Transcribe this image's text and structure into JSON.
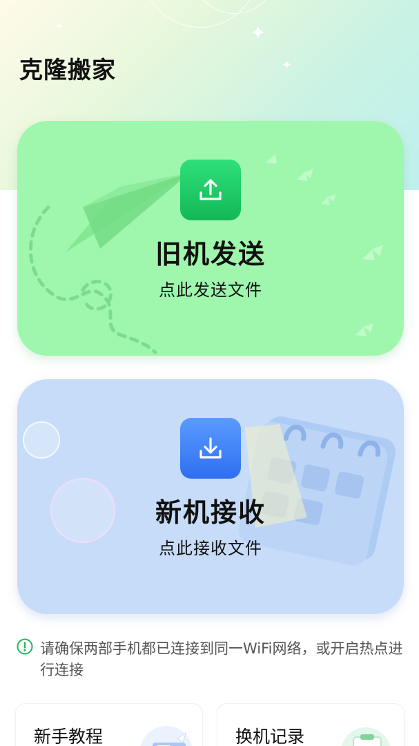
{
  "app": {
    "title": "克隆搬家"
  },
  "send_card": {
    "title": "旧机发送",
    "subtitle": "点此发送文件",
    "icon": "upload-icon",
    "color": "#9ef7ac"
  },
  "receive_card": {
    "title": "新机接收",
    "subtitle": "点此接收文件",
    "icon": "download-icon",
    "color": "#c7dcf8"
  },
  "notice": {
    "icon": "info-circle-icon",
    "text": "请确保两部手机都已连接到同一WiFi网络，或开启热点进行连接",
    "color": "#1fb85a"
  },
  "bottom": {
    "tutorial_label": "新手教程",
    "history_label": "换机记录"
  }
}
